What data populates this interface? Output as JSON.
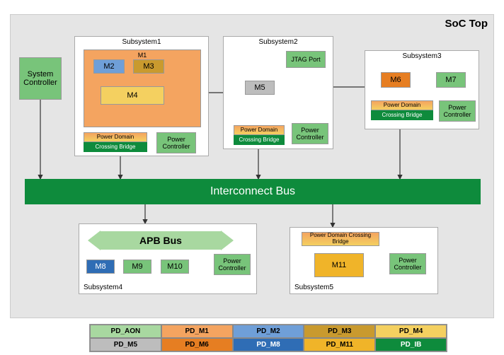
{
  "soc": {
    "title": "SoC Top"
  },
  "system_controller": "System\nController",
  "subsystems": {
    "s1": {
      "title": "Subsystem1",
      "m1": "M1",
      "m2": "M2",
      "m3": "M3",
      "m4": "M4"
    },
    "s2": {
      "title": "Subsystem2",
      "jtag": "JTAG Port",
      "m5": "M5"
    },
    "s3": {
      "title": "Subsystem3",
      "m6": "M6",
      "m7": "M7"
    },
    "s4": {
      "title": "Subsystem4",
      "apb": "APB Bus",
      "m8": "M8",
      "m9": "M9",
      "m10": "M10"
    },
    "s5": {
      "title": "Subsystem5",
      "m11": "M11"
    }
  },
  "pd_bridge": {
    "line1": "Power Domain",
    "line2": "Crossing Bridge",
    "full": "Power Domain Crossing Bridge"
  },
  "power_controller": "Power\nController",
  "interconnect": "Interconnect Bus",
  "legend": {
    "pd_aon": "PD_AON",
    "pd_m1": "PD_M1",
    "pd_m2": "PD_M2",
    "pd_m3": "PD_M3",
    "pd_m4": "PD_M4",
    "pd_m5": "PD_M5",
    "pd_m6": "PD_M6",
    "pd_m8": "PD_M8",
    "pd_m11": "PD_M11",
    "pd_ib": "PD_IB"
  }
}
